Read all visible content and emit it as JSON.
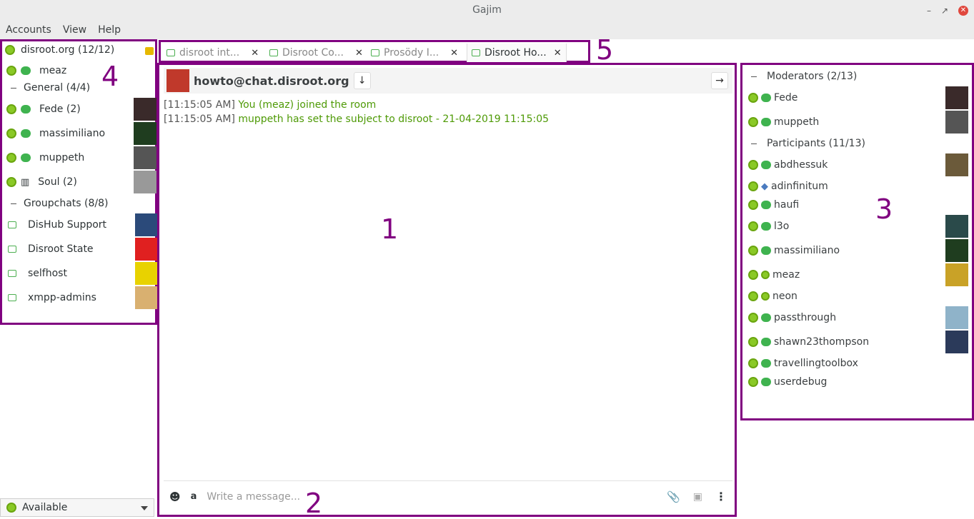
{
  "window": {
    "title": "Gajim"
  },
  "menu": [
    "Accounts",
    "View",
    "Help"
  ],
  "roster": {
    "account": "disroot.org (12/12)",
    "self_contact": "meaz",
    "groups": [
      {
        "label": "General (4/4)",
        "contacts": [
          "Fede (2)",
          "massimiliano",
          "muppeth",
          "Soul (2)"
        ]
      },
      {
        "label": "Groupchats (8/8)",
        "contacts": [
          "DisHub Support",
          "Disroot State",
          "selfhost",
          "xmpp-admins"
        ]
      }
    ],
    "status": "Available"
  },
  "tabs": [
    {
      "label": "disroot int...",
      "active": false
    },
    {
      "label": "Disroot Co...",
      "active": false
    },
    {
      "label": "Prosödy I...",
      "active": false
    },
    {
      "label": "Disroot Ho...",
      "active": true
    }
  ],
  "chat": {
    "room": "howto@chat.disroot.org",
    "messages": [
      {
        "time": "[11:15:05 AM]",
        "text": "You (meaz) joined the room"
      },
      {
        "time": "[11:15:05 AM]",
        "text": "muppeth has set the subject to disroot - 21-04-2019 11:15:05"
      }
    ],
    "composer_placeholder": "Write a message..."
  },
  "members": {
    "moderators_label": "Moderators (2/13)",
    "moderators": [
      "Fede",
      "muppeth"
    ],
    "participants_label": "Participants (11/13)",
    "participants": [
      "abdhessuk",
      "adinfinitum",
      "haufi",
      "l3o",
      "massimiliano",
      "meaz",
      "neon",
      "passthrough",
      "shawn23thompson",
      "travellingtoolbox",
      "userdebug"
    ]
  },
  "annotations": [
    "1",
    "2",
    "3",
    "4",
    "5"
  ],
  "colors": {
    "annotation": "#800080",
    "status_online": "#8ac926",
    "system_message": "#4e9a06"
  }
}
